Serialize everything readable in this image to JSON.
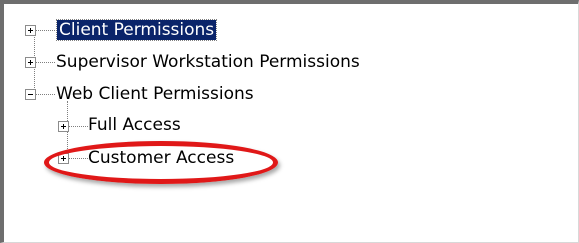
{
  "tree": {
    "items": [
      {
        "label": "Client Permissions",
        "state": "collapsed",
        "selected": true
      },
      {
        "label": "Supervisor Workstation Permissions",
        "state": "collapsed",
        "selected": false
      },
      {
        "label": "Web Client Permissions",
        "state": "expanded",
        "selected": false
      },
      {
        "label": "Full Access",
        "state": "collapsed",
        "selected": false
      },
      {
        "label": "Customer Access",
        "state": "collapsed",
        "selected": false
      }
    ]
  },
  "annotation": {
    "color": "#e01818"
  },
  "colors": {
    "selection": "#0a246a"
  }
}
